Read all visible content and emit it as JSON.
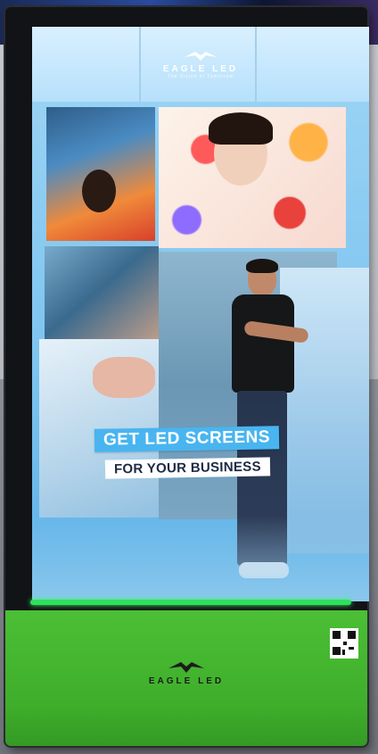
{
  "screen": {
    "logo": {
      "name": "EAGLE LED",
      "tagline": "The Vision of Tomorrow"
    },
    "headline": "GET LED SCREENS",
    "subheadline": "FOR YOUR BUSINESS"
  },
  "base": {
    "logo": {
      "name": "EAGLE LED"
    }
  },
  "colors": {
    "base_green": "#3fae2b",
    "accent_blue": "#48b5f0",
    "glow_green": "#2ee05a"
  },
  "icons": [
    "eagle-logo-icon",
    "qr-code-icon"
  ]
}
